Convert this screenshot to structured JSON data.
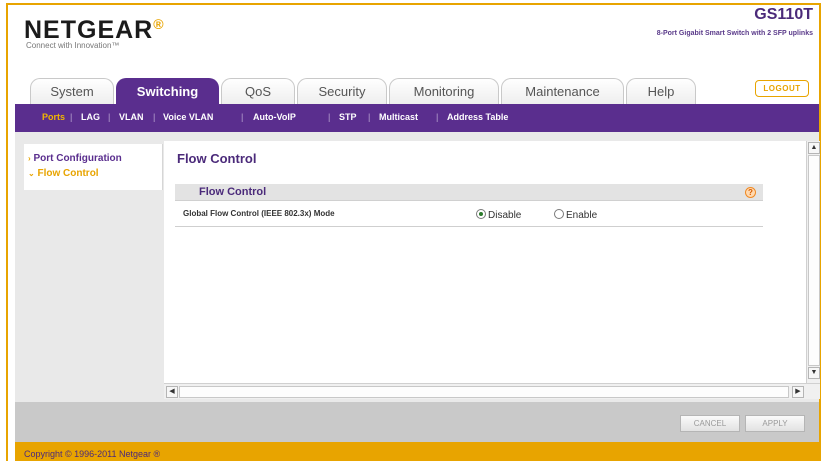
{
  "header": {
    "logo_text": "NETGEAR",
    "logo_mark": "®",
    "tagline": "Connect with Innovation™",
    "model": "GS110T",
    "description": "8-Port Gigabit Smart Switch with 2 SFP uplinks",
    "logout_label": "LOGOUT"
  },
  "tabs": [
    {
      "label": "System",
      "active": false
    },
    {
      "label": "Switching",
      "active": true
    },
    {
      "label": "QoS",
      "active": false
    },
    {
      "label": "Security",
      "active": false
    },
    {
      "label": "Monitoring",
      "active": false
    },
    {
      "label": "Maintenance",
      "active": false
    },
    {
      "label": "Help",
      "active": false
    }
  ],
  "subnav": [
    {
      "label": "Ports",
      "active": true
    },
    {
      "label": "LAG",
      "active": false
    },
    {
      "label": "VLAN",
      "active": false
    },
    {
      "label": "Voice VLAN",
      "active": false
    },
    {
      "label": "Auto-VoIP",
      "active": false
    },
    {
      "label": "STP",
      "active": false
    },
    {
      "label": "Multicast",
      "active": false
    },
    {
      "label": "Address Table",
      "active": false
    }
  ],
  "leftnav": [
    {
      "label": "Port Configuration",
      "arrow": "›",
      "active": false
    },
    {
      "label": "Flow Control",
      "arrow": "⌄",
      "active": true
    }
  ],
  "main": {
    "page_title": "Flow Control",
    "section_title": "Flow Control",
    "help_icon": "?",
    "row_label": "Global Flow Control (IEEE 802.3x) Mode",
    "options": [
      {
        "label": "Disable",
        "checked": true
      },
      {
        "label": "Enable",
        "checked": false
      }
    ]
  },
  "scroll": {
    "up": "▲",
    "down": "▼",
    "left": "◀",
    "right": "▶"
  },
  "footer": {
    "cancel_label": "CANCEL",
    "apply_label": "APPLY",
    "copyright": "Copyright © 1996-2011 Netgear ®"
  },
  "colors": {
    "brand_purple": "#5a2e8e",
    "brand_orange": "#e8a400",
    "panel_gray": "#e9e9e9"
  }
}
